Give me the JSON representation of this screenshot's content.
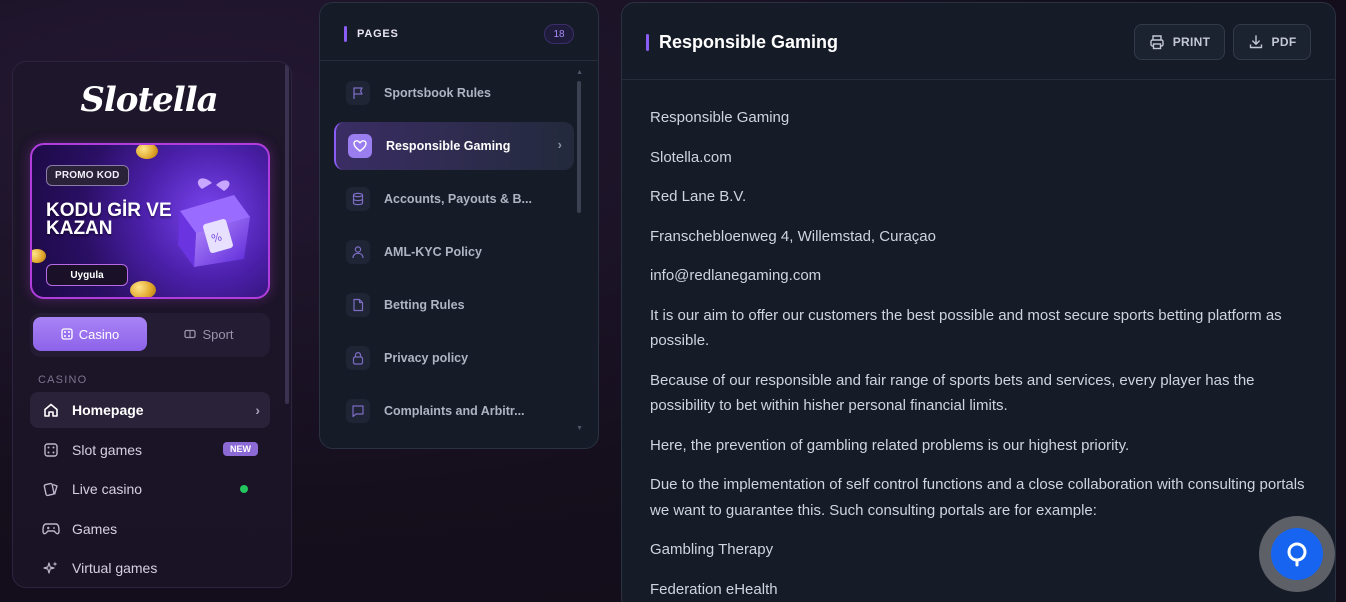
{
  "sidebar": {
    "logo": "Slotella",
    "promo": {
      "tag": "PROMO KOD",
      "title": "KODU GİR VE KAZAN",
      "button": "Uygula"
    },
    "modes": [
      {
        "label": "Casino",
        "icon": "dice-icon",
        "active": true
      },
      {
        "label": "Sport",
        "icon": "ticket-icon",
        "active": false
      }
    ],
    "section_label": "CASINO",
    "items": [
      {
        "label": "Homepage",
        "icon": "home-icon",
        "active": true
      },
      {
        "label": "Slot games",
        "icon": "slot-icon",
        "badge": "NEW"
      },
      {
        "label": "Live casino",
        "icon": "cards-icon",
        "status": "live"
      },
      {
        "label": "Games",
        "icon": "gamepad-icon"
      },
      {
        "label": "Virtual games",
        "icon": "sparkle-icon"
      }
    ]
  },
  "pages": {
    "title": "PAGES",
    "count": "18",
    "items": [
      {
        "label": "Sportsbook Rules",
        "icon": "flag-icon"
      },
      {
        "label": "Responsible Gaming",
        "icon": "heart-icon",
        "active": true
      },
      {
        "label": "Accounts, Payouts & B...",
        "icon": "database-icon"
      },
      {
        "label": "AML-KYC Policy",
        "icon": "user-icon"
      },
      {
        "label": "Betting Rules",
        "icon": "file-icon"
      },
      {
        "label": "Privacy policy",
        "icon": "lock-icon"
      },
      {
        "label": "Complaints and Arbitr...",
        "icon": "message-icon"
      }
    ]
  },
  "content": {
    "title": "Responsible Gaming",
    "print_label": "PRINT",
    "pdf_label": "PDF",
    "paragraphs": [
      "Responsible Gaming",
      "Slotella.com",
      "Red Lane B.V.",
      "Franschebloenweg 4, Willemstad, Curaçao",
      "info@redlanegaming.com",
      "It is our aim to offer our customers the best possible and most secure sports betting platform as possible.",
      "Because of our responsible and fair range of sports bets and services, every player has the possibility to bet within hisher personal financial limits.",
      "Here, the prevention of gambling related problems is our highest priority.",
      "Due to the implementation of self control functions and a close collaboration with consulting portals we want to guarantee this. Such consulting portals are for example:",
      "Gambling Therapy",
      "Federation eHealth"
    ]
  },
  "colors": {
    "accent": "#8b5cf6",
    "live": "#22c55e",
    "chat": "#1664f0"
  }
}
